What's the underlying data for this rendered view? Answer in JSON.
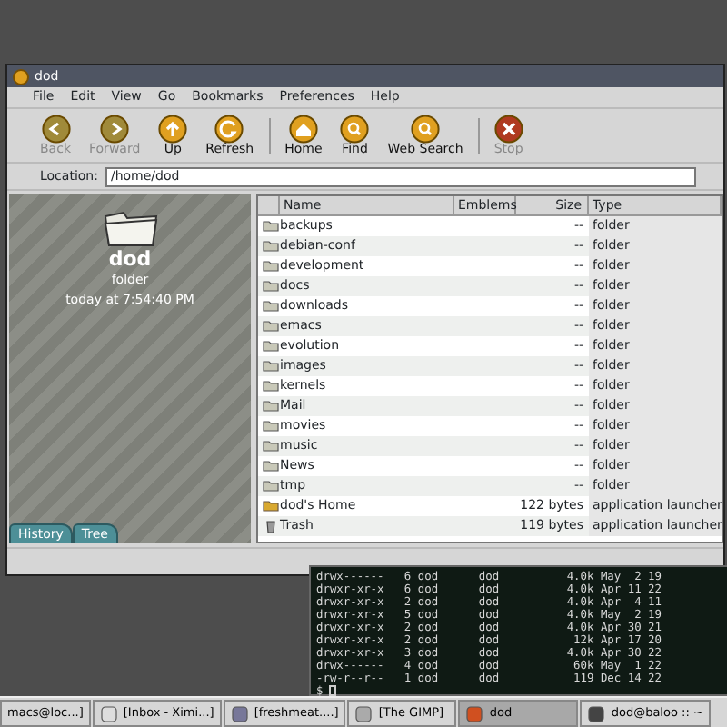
{
  "window": {
    "title": "dod"
  },
  "menu": [
    "File",
    "Edit",
    "View",
    "Go",
    "Bookmarks",
    "Preferences",
    "Help"
  ],
  "toolbar_groups": [
    [
      {
        "label": "Back",
        "disabled": true
      },
      {
        "label": "Forward",
        "disabled": true
      },
      {
        "label": "Up",
        "disabled": false
      },
      {
        "label": "Refresh",
        "disabled": false
      }
    ],
    [
      {
        "label": "Home",
        "disabled": false
      },
      {
        "label": "Find",
        "disabled": false
      },
      {
        "label": "Web Search",
        "disabled": false
      }
    ],
    [
      {
        "label": "Stop",
        "disabled": true
      }
    ]
  ],
  "location": {
    "label": "Location:",
    "value": "/home/dod"
  },
  "info_pane": {
    "name": "dod",
    "type": "folder",
    "modified": "today at 7:54:40 PM",
    "tabs": [
      {
        "label": "History",
        "selected": false
      },
      {
        "label": "Tree",
        "selected": false
      }
    ]
  },
  "table": {
    "columns": [
      "Name",
      "Emblems",
      "Size",
      "Type"
    ],
    "rows": [
      {
        "kind": "folder",
        "name": "backups",
        "size": "--",
        "type": "folder"
      },
      {
        "kind": "folder",
        "name": "debian-conf",
        "size": "--",
        "type": "folder"
      },
      {
        "kind": "folder",
        "name": "development",
        "size": "--",
        "type": "folder"
      },
      {
        "kind": "folder",
        "name": "docs",
        "size": "--",
        "type": "folder"
      },
      {
        "kind": "folder",
        "name": "downloads",
        "size": "--",
        "type": "folder"
      },
      {
        "kind": "folder",
        "name": "emacs",
        "size": "--",
        "type": "folder"
      },
      {
        "kind": "folder",
        "name": "evolution",
        "size": "--",
        "type": "folder"
      },
      {
        "kind": "folder",
        "name": "images",
        "size": "--",
        "type": "folder"
      },
      {
        "kind": "folder",
        "name": "kernels",
        "size": "--",
        "type": "folder"
      },
      {
        "kind": "folder",
        "name": "Mail",
        "size": "--",
        "type": "folder"
      },
      {
        "kind": "folder",
        "name": "movies",
        "size": "--",
        "type": "folder"
      },
      {
        "kind": "folder",
        "name": "music",
        "size": "--",
        "type": "folder"
      },
      {
        "kind": "folder",
        "name": "News",
        "size": "--",
        "type": "folder"
      },
      {
        "kind": "folder",
        "name": "tmp",
        "size": "--",
        "type": "folder"
      },
      {
        "kind": "launcher",
        "name": "dod's Home",
        "size": "122 bytes",
        "type": "application launcher"
      },
      {
        "kind": "trash",
        "name": "Trash",
        "size": "119 bytes",
        "type": "application launcher"
      }
    ]
  },
  "terminal": {
    "lines": [
      "drwx------   6 dod      dod          4.0k May  2 19",
      "drwxr-xr-x   6 dod      dod          4.0k Apr 11 22",
      "drwxr-xr-x   2 dod      dod          4.0k Apr  4 11",
      "drwxr-xr-x   5 dod      dod          4.0k May  2 19",
      "drwxr-xr-x   2 dod      dod          4.0k Apr 30 21",
      "drwxr-xr-x   2 dod      dod           12k Apr 17 20",
      "drwxr-xr-x   3 dod      dod          4.0k Apr 30 22",
      "drwx------   4 dod      dod           60k May  1 22",
      "-rw-r--r--   1 dod      dod           119 Dec 14 22"
    ],
    "prompt": "$"
  },
  "taskbar": [
    {
      "label": "macs@loc...]",
      "selected": false
    },
    {
      "label": "[Inbox - Ximi...]",
      "selected": false
    },
    {
      "label": "[freshmeat....]",
      "selected": false
    },
    {
      "label": "[The GIMP]",
      "selected": false
    },
    {
      "label": "dod",
      "selected": true
    },
    {
      "label": "dod@baloo :: ~",
      "selected": false
    }
  ]
}
